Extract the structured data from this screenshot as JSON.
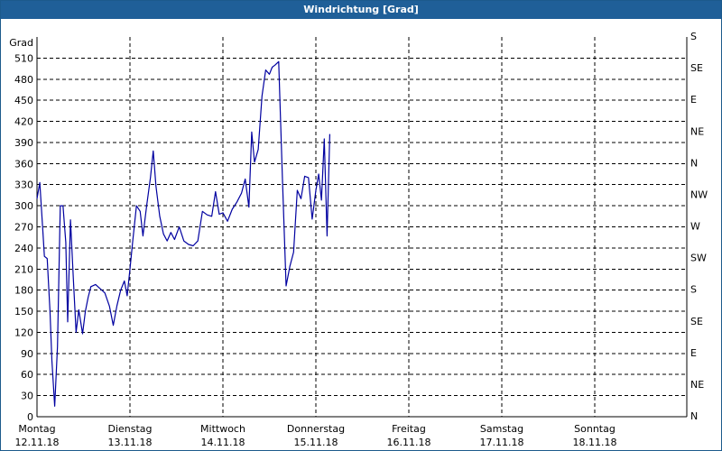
{
  "window": {
    "title": "Windrichtung [Grad]"
  },
  "chart_data": {
    "type": "line",
    "title": "Windrichtung [Grad]",
    "ylabel": "Grad",
    "ylim": [
      0,
      540
    ],
    "yticks": [
      0,
      30,
      60,
      90,
      120,
      150,
      180,
      210,
      240,
      270,
      300,
      330,
      360,
      390,
      420,
      450,
      480,
      510
    ],
    "right_axis_labels": [
      "N",
      "NE",
      "E",
      "SE",
      "S",
      "SW",
      "W",
      "NW",
      "N",
      "NE",
      "E",
      "SE",
      "S"
    ],
    "xlim": [
      0,
      7
    ],
    "x_unit": "days since Montag 12.11.18 00:00",
    "x_categories": [
      {
        "day": "Montag",
        "date": "12.11.18"
      },
      {
        "day": "Dienstag",
        "date": "13.11.18"
      },
      {
        "day": "Mittwoch",
        "date": "14.11.18"
      },
      {
        "day": "Donnerstag",
        "date": "15.11.18"
      },
      {
        "day": "Freitag",
        "date": "16.11.18"
      },
      {
        "day": "Samstag",
        "date": "17.11.18"
      },
      {
        "day": "Sonntag",
        "date": "18.11.18"
      }
    ],
    "grid": true,
    "line_color": "#0000a0",
    "series": [
      {
        "name": "",
        "points": [
          [
            0.0,
            310
          ],
          [
            0.03,
            333
          ],
          [
            0.06,
            270
          ],
          [
            0.08,
            228
          ],
          [
            0.11,
            225
          ],
          [
            0.14,
            150
          ],
          [
            0.16,
            80
          ],
          [
            0.19,
            15
          ],
          [
            0.22,
            100
          ],
          [
            0.25,
            300
          ],
          [
            0.28,
            300
          ],
          [
            0.31,
            248
          ],
          [
            0.33,
            135
          ],
          [
            0.36,
            280
          ],
          [
            0.39,
            198
          ],
          [
            0.42,
            120
          ],
          [
            0.45,
            152
          ],
          [
            0.49,
            118
          ],
          [
            0.52,
            150
          ],
          [
            0.55,
            170
          ],
          [
            0.58,
            185
          ],
          [
            0.63,
            188
          ],
          [
            0.68,
            182
          ],
          [
            0.73,
            176
          ],
          [
            0.78,
            157
          ],
          [
            0.82,
            130
          ],
          [
            0.86,
            158
          ],
          [
            0.9,
            180
          ],
          [
            0.94,
            193
          ],
          [
            0.97,
            172
          ],
          [
            1.0,
            210
          ],
          [
            1.03,
            250
          ],
          [
            1.07,
            300
          ],
          [
            1.11,
            292
          ],
          [
            1.14,
            257
          ],
          [
            1.18,
            300
          ],
          [
            1.22,
            340
          ],
          [
            1.25,
            378
          ],
          [
            1.28,
            328
          ],
          [
            1.32,
            285
          ],
          [
            1.36,
            260
          ],
          [
            1.4,
            250
          ],
          [
            1.44,
            262
          ],
          [
            1.48,
            252
          ],
          [
            1.53,
            270
          ],
          [
            1.58,
            250
          ],
          [
            1.63,
            245
          ],
          [
            1.68,
            243
          ],
          [
            1.73,
            250
          ],
          [
            1.78,
            292
          ],
          [
            1.83,
            287
          ],
          [
            1.88,
            285
          ],
          [
            1.92,
            320
          ],
          [
            1.96,
            288
          ],
          [
            2.0,
            290
          ],
          [
            2.05,
            278
          ],
          [
            2.1,
            295
          ],
          [
            2.15,
            305
          ],
          [
            2.2,
            318
          ],
          [
            2.24,
            338
          ],
          [
            2.28,
            298
          ],
          [
            2.31,
            405
          ],
          [
            2.34,
            362
          ],
          [
            2.38,
            380
          ],
          [
            2.42,
            456
          ],
          [
            2.46,
            493
          ],
          [
            2.5,
            487
          ],
          [
            2.53,
            497
          ],
          [
            2.56,
            500
          ],
          [
            2.6,
            505
          ],
          [
            2.64,
            340
          ],
          [
            2.68,
            186
          ],
          [
            2.72,
            214
          ],
          [
            2.76,
            234
          ],
          [
            2.8,
            322
          ],
          [
            2.84,
            310
          ],
          [
            2.88,
            342
          ],
          [
            2.92,
            340
          ],
          [
            2.96,
            281
          ],
          [
            3.0,
            322
          ],
          [
            3.03,
            345
          ],
          [
            3.06,
            308
          ],
          [
            3.09,
            395
          ],
          [
            3.12,
            257
          ],
          [
            3.15,
            402
          ]
        ]
      }
    ]
  }
}
